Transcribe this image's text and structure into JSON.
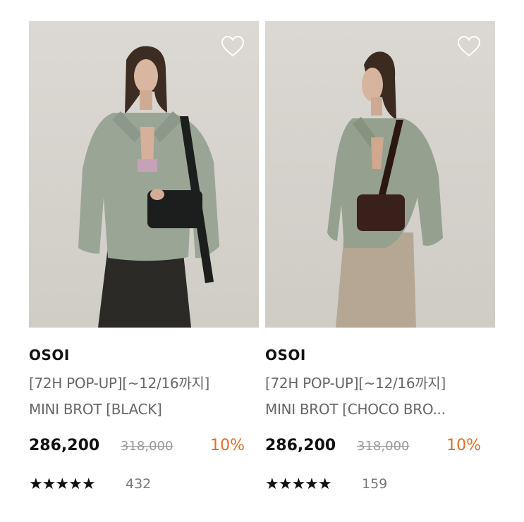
{
  "products": [
    {
      "brand": "OSOI",
      "line1": "[72H POP-UP][~12/16까지]",
      "line2": "MINI BROT [BLACK]",
      "price": "286,200",
      "original_price": "318,000",
      "discount": "10%",
      "stars": "★★★★★",
      "rating": 5,
      "review_count": "432",
      "icon": "heart-outline-icon",
      "bag_color": "#1c1d1d"
    },
    {
      "brand": "OSOI",
      "line1": "[72H POP-UP][~12/16까지]",
      "line2": "MINI BROT [CHOCO BRO...",
      "price": "286,200",
      "original_price": "318,000",
      "discount": "10%",
      "stars": "★★★★★",
      "rating": 5,
      "review_count": "159",
      "icon": "heart-outline-icon",
      "bag_color": "#3a201a"
    }
  ],
  "colors": {
    "discount": "#ea6a22",
    "price": "#111111",
    "muted": "#666666",
    "strike": "#9a9a9a",
    "photo_background": "#d9d6d1",
    "jacket": "#9aa596"
  }
}
